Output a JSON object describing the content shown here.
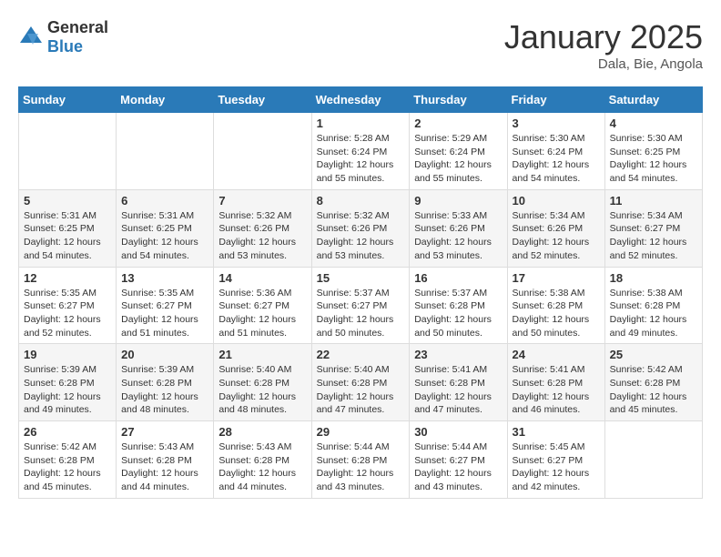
{
  "logo": {
    "text_general": "General",
    "text_blue": "Blue"
  },
  "title": "January 2025",
  "location": "Dala, Bie, Angola",
  "weekdays": [
    "Sunday",
    "Monday",
    "Tuesday",
    "Wednesday",
    "Thursday",
    "Friday",
    "Saturday"
  ],
  "weeks": [
    [
      {
        "day": "",
        "info": ""
      },
      {
        "day": "",
        "info": ""
      },
      {
        "day": "",
        "info": ""
      },
      {
        "day": "1",
        "info": "Sunrise: 5:28 AM\nSunset: 6:24 PM\nDaylight: 12 hours\nand 55 minutes."
      },
      {
        "day": "2",
        "info": "Sunrise: 5:29 AM\nSunset: 6:24 PM\nDaylight: 12 hours\nand 55 minutes."
      },
      {
        "day": "3",
        "info": "Sunrise: 5:30 AM\nSunset: 6:24 PM\nDaylight: 12 hours\nand 54 minutes."
      },
      {
        "day": "4",
        "info": "Sunrise: 5:30 AM\nSunset: 6:25 PM\nDaylight: 12 hours\nand 54 minutes."
      }
    ],
    [
      {
        "day": "5",
        "info": "Sunrise: 5:31 AM\nSunset: 6:25 PM\nDaylight: 12 hours\nand 54 minutes."
      },
      {
        "day": "6",
        "info": "Sunrise: 5:31 AM\nSunset: 6:25 PM\nDaylight: 12 hours\nand 54 minutes."
      },
      {
        "day": "7",
        "info": "Sunrise: 5:32 AM\nSunset: 6:26 PM\nDaylight: 12 hours\nand 53 minutes."
      },
      {
        "day": "8",
        "info": "Sunrise: 5:32 AM\nSunset: 6:26 PM\nDaylight: 12 hours\nand 53 minutes."
      },
      {
        "day": "9",
        "info": "Sunrise: 5:33 AM\nSunset: 6:26 PM\nDaylight: 12 hours\nand 53 minutes."
      },
      {
        "day": "10",
        "info": "Sunrise: 5:34 AM\nSunset: 6:26 PM\nDaylight: 12 hours\nand 52 minutes."
      },
      {
        "day": "11",
        "info": "Sunrise: 5:34 AM\nSunset: 6:27 PM\nDaylight: 12 hours\nand 52 minutes."
      }
    ],
    [
      {
        "day": "12",
        "info": "Sunrise: 5:35 AM\nSunset: 6:27 PM\nDaylight: 12 hours\nand 52 minutes."
      },
      {
        "day": "13",
        "info": "Sunrise: 5:35 AM\nSunset: 6:27 PM\nDaylight: 12 hours\nand 51 minutes."
      },
      {
        "day": "14",
        "info": "Sunrise: 5:36 AM\nSunset: 6:27 PM\nDaylight: 12 hours\nand 51 minutes."
      },
      {
        "day": "15",
        "info": "Sunrise: 5:37 AM\nSunset: 6:27 PM\nDaylight: 12 hours\nand 50 minutes."
      },
      {
        "day": "16",
        "info": "Sunrise: 5:37 AM\nSunset: 6:28 PM\nDaylight: 12 hours\nand 50 minutes."
      },
      {
        "day": "17",
        "info": "Sunrise: 5:38 AM\nSunset: 6:28 PM\nDaylight: 12 hours\nand 50 minutes."
      },
      {
        "day": "18",
        "info": "Sunrise: 5:38 AM\nSunset: 6:28 PM\nDaylight: 12 hours\nand 49 minutes."
      }
    ],
    [
      {
        "day": "19",
        "info": "Sunrise: 5:39 AM\nSunset: 6:28 PM\nDaylight: 12 hours\nand 49 minutes."
      },
      {
        "day": "20",
        "info": "Sunrise: 5:39 AM\nSunset: 6:28 PM\nDaylight: 12 hours\nand 48 minutes."
      },
      {
        "day": "21",
        "info": "Sunrise: 5:40 AM\nSunset: 6:28 PM\nDaylight: 12 hours\nand 48 minutes."
      },
      {
        "day": "22",
        "info": "Sunrise: 5:40 AM\nSunset: 6:28 PM\nDaylight: 12 hours\nand 47 minutes."
      },
      {
        "day": "23",
        "info": "Sunrise: 5:41 AM\nSunset: 6:28 PM\nDaylight: 12 hours\nand 47 minutes."
      },
      {
        "day": "24",
        "info": "Sunrise: 5:41 AM\nSunset: 6:28 PM\nDaylight: 12 hours\nand 46 minutes."
      },
      {
        "day": "25",
        "info": "Sunrise: 5:42 AM\nSunset: 6:28 PM\nDaylight: 12 hours\nand 45 minutes."
      }
    ],
    [
      {
        "day": "26",
        "info": "Sunrise: 5:42 AM\nSunset: 6:28 PM\nDaylight: 12 hours\nand 45 minutes."
      },
      {
        "day": "27",
        "info": "Sunrise: 5:43 AM\nSunset: 6:28 PM\nDaylight: 12 hours\nand 44 minutes."
      },
      {
        "day": "28",
        "info": "Sunrise: 5:43 AM\nSunset: 6:28 PM\nDaylight: 12 hours\nand 44 minutes."
      },
      {
        "day": "29",
        "info": "Sunrise: 5:44 AM\nSunset: 6:28 PM\nDaylight: 12 hours\nand 43 minutes."
      },
      {
        "day": "30",
        "info": "Sunrise: 5:44 AM\nSunset: 6:27 PM\nDaylight: 12 hours\nand 43 minutes."
      },
      {
        "day": "31",
        "info": "Sunrise: 5:45 AM\nSunset: 6:27 PM\nDaylight: 12 hours\nand 42 minutes."
      },
      {
        "day": "",
        "info": ""
      }
    ]
  ]
}
